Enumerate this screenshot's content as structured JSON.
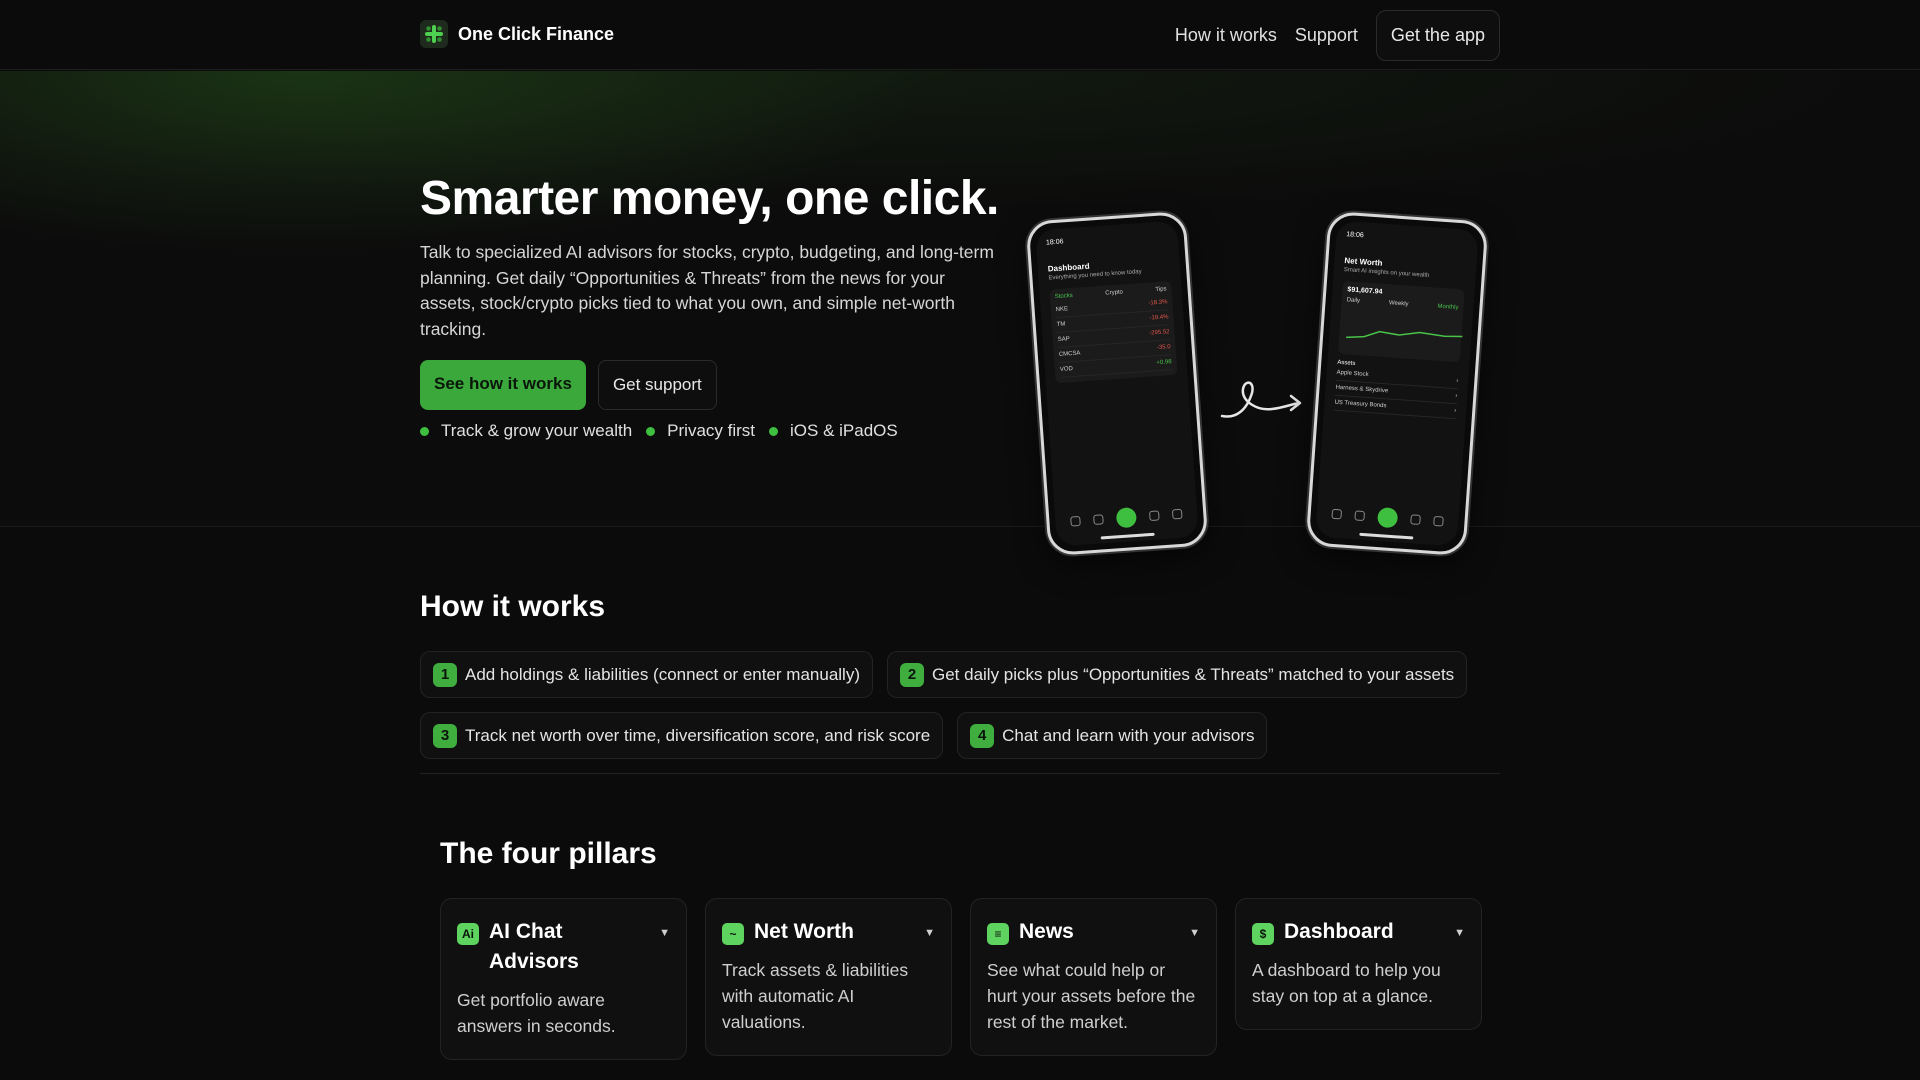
{
  "nav": {
    "brand": "One Click Finance",
    "links": [
      "How it works",
      "Support"
    ],
    "cta": "Get the app"
  },
  "hero": {
    "title": "Smarter money, one click.",
    "description": "Talk to specialized AI advisors for stocks, crypto, budgeting, and long-term planning. Get daily “Opportunities & Threats” from the news for your assets, stock/crypto picks tied to what you own, and simple net-worth tracking.",
    "primary_button": "See how it works",
    "secondary_button": "Get support",
    "features": [
      "Track & grow your wealth",
      "Privacy first",
      "iOS & iPadOS"
    ],
    "accent_color": "#3fbf3f"
  },
  "phone_left": {
    "time": "18:06",
    "heading": "Dashboard",
    "subheading": "Everything you need to know today",
    "tabs": [
      "Stocks",
      "Crypto",
      "Tips"
    ],
    "rows": [
      {
        "ticker": "NKE",
        "change": "-18.3%"
      },
      {
        "ticker": "TM",
        "change": "-19.4%"
      },
      {
        "ticker": "SAP",
        "change": "-295.52"
      },
      {
        "ticker": "CMCSA",
        "change": "-35.0"
      },
      {
        "ticker": "VOD",
        "change": "+0.98"
      }
    ]
  },
  "phone_right": {
    "time": "18:06",
    "heading": "Net Worth",
    "subheading": "Smart AI insights on your wealth",
    "value": "$91,607.94",
    "tabs": [
      "Daily",
      "Weekly",
      "Monthly"
    ],
    "assets_label": "Assets",
    "assets": [
      "Apple Stock",
      "Harness & Skydrive",
      "US Treasury Bonds"
    ]
  },
  "how": {
    "title": "How it works",
    "steps": [
      {
        "n": "1",
        "text": "Add holdings & liabilities (connect or enter manually)"
      },
      {
        "n": "2",
        "text": "Get daily picks plus “Opportunities & Threats” matched to your assets"
      },
      {
        "n": "3",
        "text": "Track net worth over time, diversification score, and risk score"
      },
      {
        "n": "4",
        "text": "Chat and learn with your advisors"
      }
    ]
  },
  "pillars": {
    "title": "The four pillars",
    "items": [
      {
        "name": "AI Chat Advisors",
        "icon": "ai-chat-icon",
        "glyph": "Ai",
        "desc": "Get portfolio aware answers in seconds."
      },
      {
        "name": "Net Worth",
        "icon": "trend-chart-icon",
        "glyph": "~",
        "desc": "Track assets & liabilities with automatic AI valuations."
      },
      {
        "name": "News",
        "icon": "newspaper-icon",
        "glyph": "≡",
        "desc": "See what could help or hurt your assets before the rest of the market."
      },
      {
        "name": "Dashboard",
        "icon": "dollar-shield-icon",
        "glyph": "$",
        "desc": "A dashboard to help you stay on top at a glance."
      }
    ]
  }
}
